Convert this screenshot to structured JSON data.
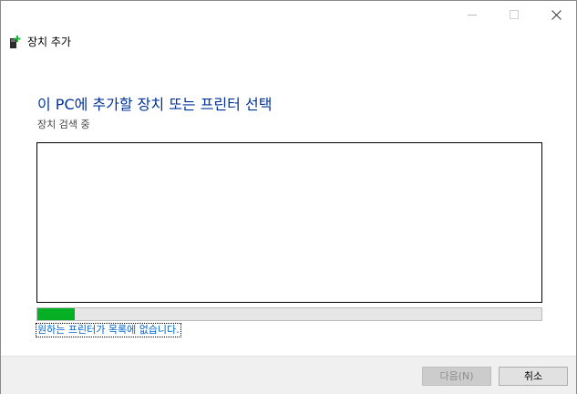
{
  "window": {
    "title": "장치 추가",
    "controls": {
      "minimize": "minimize-icon",
      "maximize": "maximize-icon",
      "close": "close-icon"
    }
  },
  "main": {
    "heading": "이 PC에 추가할 장치 또는 프린터 선택",
    "status": "장치 검색 중",
    "device_list": [],
    "progress": 0.075,
    "help_link": "원하는 프린터가 목록에 없습니다."
  },
  "footer": {
    "next_label": "다음(N)",
    "cancel_label": "취소"
  },
  "colors": {
    "heading": "#003399",
    "progress": "#06b025",
    "link": "#0066cc"
  }
}
